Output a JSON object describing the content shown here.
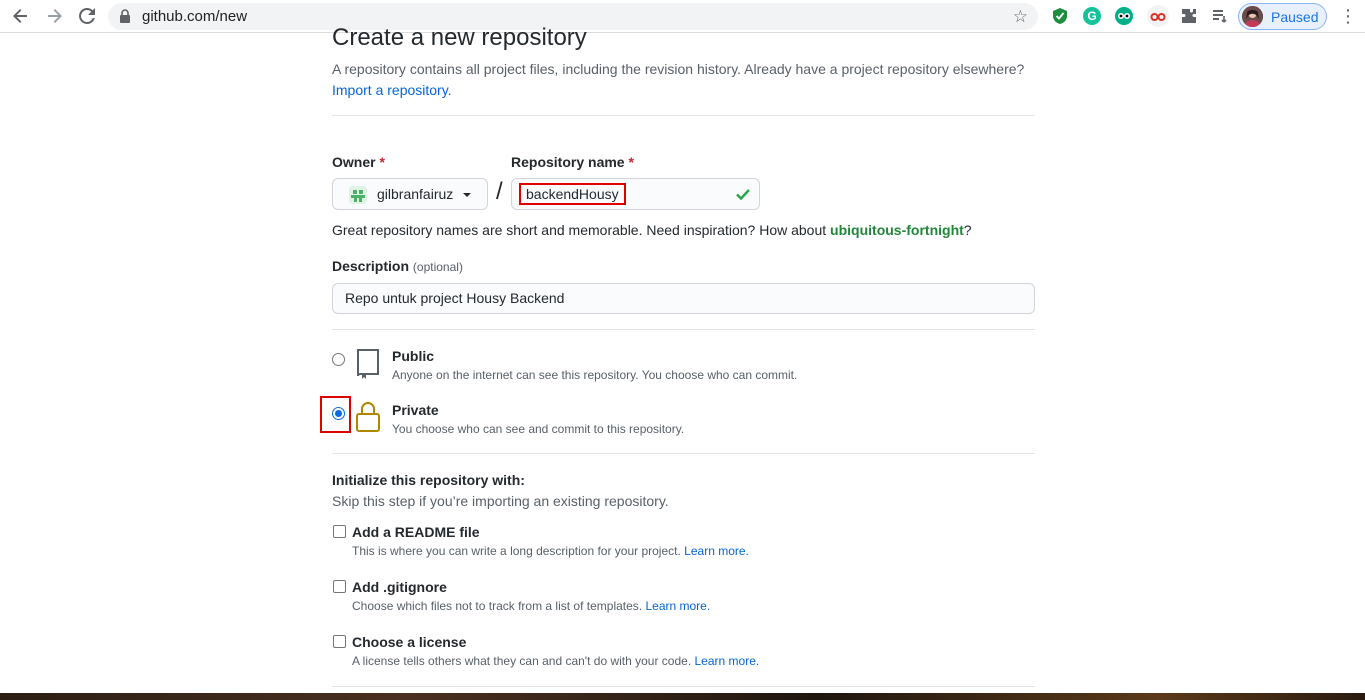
{
  "browser": {
    "url": "github.com/new",
    "profile_label": "Paused"
  },
  "page": {
    "title": "Create a new repository",
    "subtitle": "A repository contains all project files, including the revision history. Already have a project repository elsewhere?",
    "import_link": "Import a repository."
  },
  "owner": {
    "label": "Owner",
    "required_mark": "*",
    "value": "gilbranfairuz"
  },
  "separator": "/",
  "repo_name": {
    "label": "Repository name",
    "required_mark": "*",
    "value": "backendHousy"
  },
  "name_hint": {
    "prefix": "Great repository names are short and memorable. Need inspiration? How about",
    "suggestion": "ubiquitous-fortnight",
    "suffix": "?"
  },
  "description": {
    "label": "Description",
    "optional": "(optional)",
    "value": "Repo untuk project Housy Backend"
  },
  "visibility": {
    "public": {
      "title": "Public",
      "note": "Anyone on the internet can see this repository. You choose who can commit.",
      "selected": false
    },
    "private": {
      "title": "Private",
      "note": "You choose who can see and commit to this repository.",
      "selected": true
    }
  },
  "init": {
    "title": "Initialize this repository with:",
    "note": "Skip this step if you’re importing an existing repository.",
    "learn_more": "Learn more.",
    "items": [
      {
        "title": "Add a README file",
        "note": "This is where you can write a long description for your project."
      },
      {
        "title": "Add .gitignore",
        "note": "Choose which files not to track from a list of templates."
      },
      {
        "title": "Choose a license",
        "note": "A license tells others what they can and can't do with your code."
      }
    ]
  },
  "colors": {
    "link": "#0366d6",
    "suggestion": "#22863a",
    "required": "#cb2431",
    "highlight": "#e00000",
    "radio_selected": "#0b6bde"
  }
}
